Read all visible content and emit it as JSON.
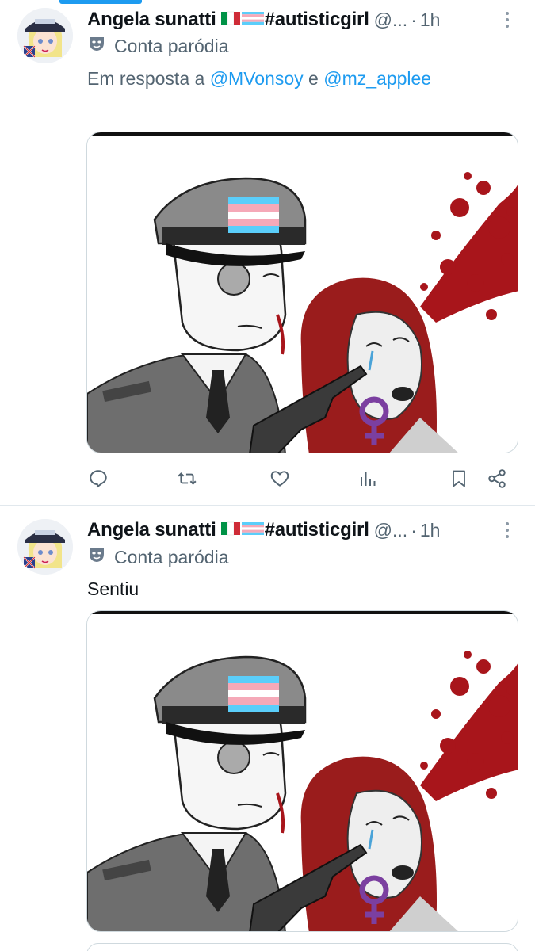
{
  "tweets": [
    {
      "display_name": "Angela sunatti",
      "flags": [
        "italy-flag",
        "trans-flag"
      ],
      "hashtag": "#autisticgirl",
      "handle": "@...",
      "separator": "·",
      "time": "1h",
      "badge_label": "Conta paródia",
      "badge_icon": "parody-mask-icon",
      "reply_prefix": "Em resposta a",
      "reply_mention_1": "@MVonsoy",
      "reply_connector": "e",
      "reply_mention_2": "@mz_applee",
      "text": "",
      "actions": [
        "reply-icon",
        "retweet-icon",
        "like-icon",
        "views-icon",
        "bookmark-icon",
        "share-icon"
      ]
    },
    {
      "display_name": "Angela sunatti",
      "flags": [
        "italy-flag",
        "trans-flag"
      ],
      "hashtag": "#autisticgirl",
      "handle": "@...",
      "separator": "·",
      "time": "1h",
      "badge_label": "Conta paródia",
      "badge_icon": "parody-mask-icon",
      "text": "Sentiu"
    }
  ],
  "colors": {
    "accent": "#1d9bf0",
    "secondary_text": "#536471",
    "primary_text": "#0f1419",
    "divider": "#e1e8ed"
  }
}
